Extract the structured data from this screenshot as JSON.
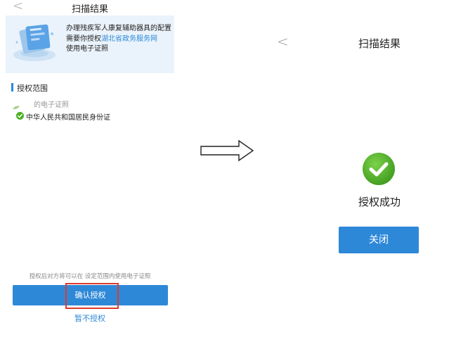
{
  "left_screen": {
    "header": {
      "back_glyph": "<",
      "title": "扫描结果"
    },
    "info_card": {
      "illustration": "id-card-illustration",
      "line1": "办理残疾军人康复辅助器具的配置",
      "line2_prefix": "需要你授权",
      "line2_link": "湖北省政务服务网",
      "line3": "使用电子证照"
    },
    "scope": {
      "title": "授权范围",
      "subtitle": "的电子证照",
      "items": [
        {
          "label": "中华人民共和国居民身份证",
          "checked": true
        }
      ]
    },
    "hint": "授权后对方将可以在 设定范围内使用电子证照",
    "confirm_button": "确认授权",
    "decline_link": "暂不授权"
  },
  "arrow": {
    "direction": "right"
  },
  "right_screen": {
    "header": {
      "back_glyph": "<",
      "title": "扫描结果"
    },
    "status_icon": "check-circle-icon",
    "status_text": "授权成功",
    "close_button": "关闭"
  },
  "colors": {
    "primary": "#2e88d8",
    "success": "#4caf26",
    "highlight": "#e03a2b",
    "card_bg": "#eaf3fb"
  }
}
